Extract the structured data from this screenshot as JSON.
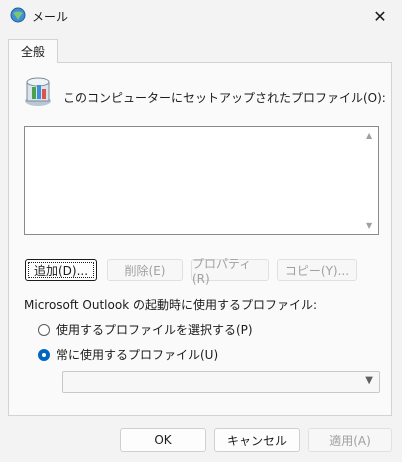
{
  "window": {
    "title": "メール",
    "close_glyph": "✕"
  },
  "tabs": [
    {
      "label": "全般"
    }
  ],
  "general": {
    "intro_text": "このコンピューターにセットアップされたプロファイル(O):",
    "profile_list": [],
    "buttons": {
      "add": "追加(D)...",
      "remove": "削除(E)",
      "properties": "プロパティ(R)",
      "copy": "コピー(Y)..."
    },
    "startup_caption": "Microsoft Outlook の起動時に使用するプロファイル:",
    "radio_prompt": "使用するプロファイルを選択する(P)",
    "radio_always": "常に使用するプロファイル(U)",
    "selected_radio": "always",
    "profile_combo_value": ""
  },
  "footer": {
    "ok": "OK",
    "cancel": "キャンセル",
    "apply": "適用(A)"
  },
  "colors": {
    "accent": "#0067c0",
    "background": "#f3f3f3",
    "panel": "#fafafa"
  }
}
